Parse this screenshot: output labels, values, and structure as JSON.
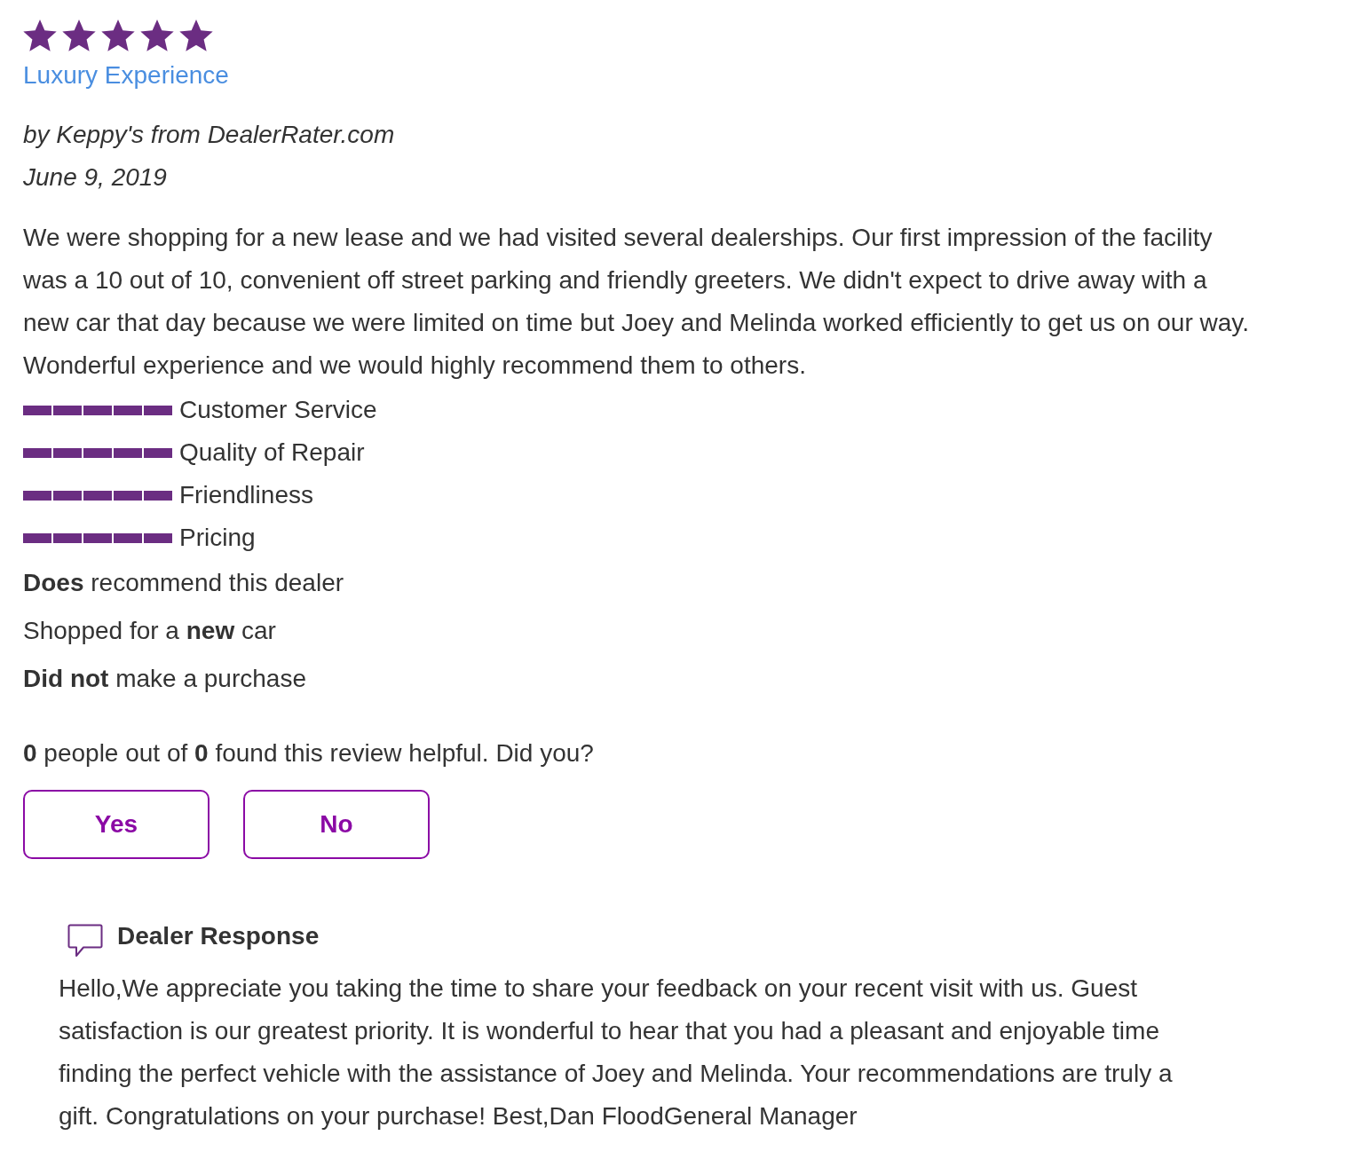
{
  "review": {
    "stars": 5,
    "title": "Luxury Experience",
    "author": "by Keppy's from DealerRater.com",
    "date": "June 9, 2019",
    "body": "We were shopping for a new lease and we had visited several dealerships. Our first impression of the facility was a 10 out of 10, convenient off street parking and friendly greeters. We didn't expect to drive away with a new car that day because we were limited on time but Joey and Melinda worked efficiently to get us on our way. Wonderful experience and we would highly recommend them to others."
  },
  "ratings": [
    {
      "label": "Customer Service",
      "stars": 5
    },
    {
      "label": "Quality of Repair",
      "stars": 5
    },
    {
      "label": "Friendliness",
      "stars": 5
    },
    {
      "label": "Pricing",
      "stars": 5
    }
  ],
  "facts": [
    "**Does** recommend this dealer",
    "Shopped for a **new** car",
    "**Did not** make a purchase"
  ],
  "helpful": {
    "text": "**0** people out of **0** found this review helpful. Did you?",
    "buttons": [
      {
        "label": "Yes"
      },
      {
        "label": "No"
      }
    ]
  },
  "dealer_response": {
    "heading": "Dealer Response",
    "body": "Hello,We appreciate you taking the time to share your feedback on your recent visit with us. Guest satisfaction is our greatest priority. It is wonderful to hear that you had a pleasant and enjoyable time finding the perfect vehicle with the assistance of Joey and Melinda. Your recommendations are truly a gift. Congratulations on your purchase! Best,Dan FloodGeneral Manager"
  }
}
